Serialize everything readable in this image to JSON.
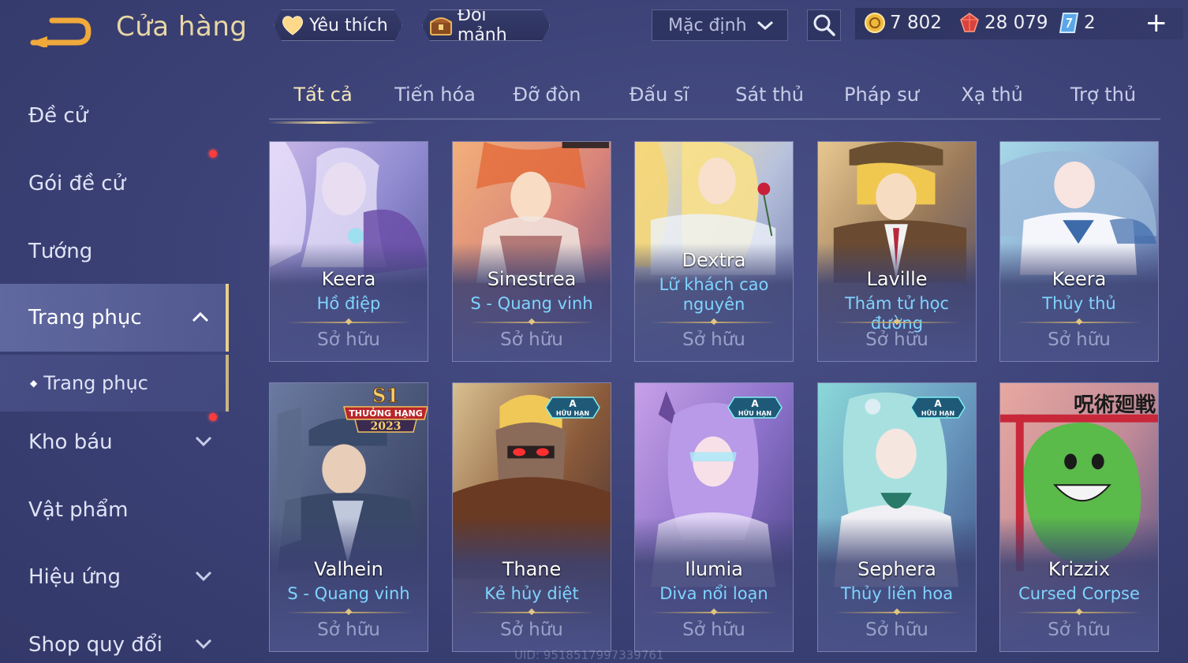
{
  "header": {
    "title": "Cửa hàng",
    "favorites_label": "Yêu thích",
    "exchange_label": "Đổi mảnh",
    "sort_label": "Mặc định"
  },
  "wallet": {
    "gold": "7 802",
    "rubies": "28 079",
    "vouchers": "2"
  },
  "sidebar": {
    "items": [
      {
        "label": "Đề cử"
      },
      {
        "label": "Gói đề cử"
      },
      {
        "label": "Tướng"
      },
      {
        "label": "Trang phục"
      },
      {
        "label": "Trang phục"
      },
      {
        "label": "Kho báu"
      },
      {
        "label": "Vật phẩm"
      },
      {
        "label": "Hiệu ứng"
      },
      {
        "label": "Shop quy đổi"
      }
    ]
  },
  "tabs": [
    "Tất cả",
    "Tiến hóa",
    "Đỡ đòn",
    "Đấu sĩ",
    "Sát thủ",
    "Pháp sư",
    "Xạ thủ",
    "Trợ thủ"
  ],
  "cards": [
    {
      "hero": "Keera",
      "skin": "Hồ điệp",
      "status": "Sở hữu"
    },
    {
      "hero": "Sinestrea",
      "skin": "S - Quang vinh",
      "status": "Sở hữu"
    },
    {
      "hero": "Dextra",
      "skin": "Lữ khách cao",
      "skin2": "nguyên",
      "status": "Sở hữu"
    },
    {
      "hero": "Laville",
      "skin": "Thám tử học đường",
      "status": "Sở hữu"
    },
    {
      "hero": "Keera",
      "skin": "Thủy thủ",
      "status": "Sở hữu"
    },
    {
      "hero": "Valhein",
      "skin": "S - Quang vinh",
      "status": "Sở hữu",
      "badge_top": "S1",
      "badge_mid": "THƯỞNG HẠNG",
      "badge_bot": "2023"
    },
    {
      "hero": "Thane",
      "skin": "Kẻ hủy diệt",
      "status": "Sở hữu",
      "badge_letter": "A",
      "badge_text": "HỮU HẠN"
    },
    {
      "hero": "Ilumia",
      "skin": "Diva nổi loạn",
      "status": "Sở hữu",
      "badge_letter": "A",
      "badge_text": "HỮU HẠN"
    },
    {
      "hero": "Sephera",
      "skin": "Thủy liên hoa",
      "status": "Sở hữu",
      "badge_letter": "A",
      "badge_text": "HỮU HẠN"
    },
    {
      "hero": "Krizzix",
      "skin": "Cursed Corpse",
      "status": "Sở hữu",
      "corner_text": "呪術廻戦"
    }
  ],
  "footer": {
    "uid": "UID: 9518517997339761"
  },
  "colors": {
    "accent_gold": "#e8d7a6",
    "skin_name": "#7fd4ff",
    "notification": "#ff3b3b"
  }
}
